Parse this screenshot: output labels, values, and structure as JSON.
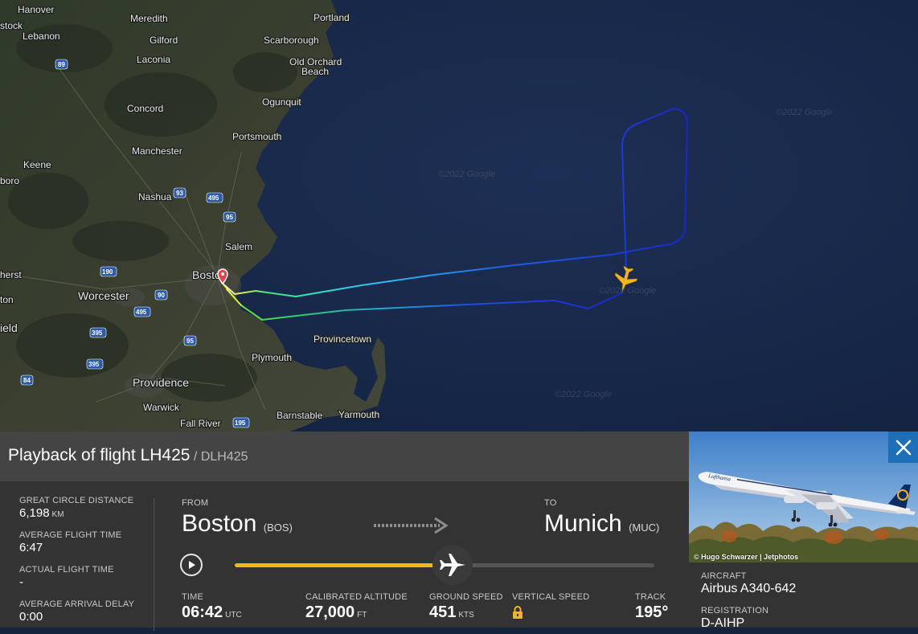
{
  "map": {
    "labels": {
      "hanover": "Hanover",
      "meredith": "Meredith",
      "portland": "Portland",
      "stock": "stock",
      "lebanon": "Lebanon",
      "gilford": "Gilford",
      "scarborough": "Scarborough",
      "laconia": "Laconia",
      "old_orchard": "Old Orchard",
      "beach": "Beach",
      "ogunquit": "Ogunquit",
      "concord": "Concord",
      "portsmouth": "Portsmouth",
      "manchester": "Manchester",
      "keene": "Keene",
      "boro": "boro",
      "nashua": "Nashua",
      "salem": "Salem",
      "herst": "herst",
      "boston": "Boston",
      "worcester": "Worcester",
      "ton": "ton",
      "field": "ield",
      "provincetown": "Provincetown",
      "plymouth": "Plymouth",
      "providence": "Providence",
      "warwick": "Warwick",
      "fall_river": "Fall River",
      "barnstable": "Barnstable",
      "yarmouth": "Yarmouth"
    },
    "shields": {
      "s89": "89",
      "s93a": "93",
      "s495a": "495",
      "s95a": "95",
      "s190": "190",
      "s90": "90",
      "s495b": "495",
      "s395a": "395",
      "s95b": "95",
      "s395b": "395",
      "s84": "84",
      "s195": "195"
    }
  },
  "flight": {
    "title": "Playback of flight LH425",
    "callsign": "/ DLH425",
    "from_label": "FROM",
    "from_city": "Boston",
    "from_code": "(BOS)",
    "to_label": "TO",
    "to_city": "Munich",
    "to_code": "(MUC)",
    "progress": 0.52,
    "colors": {
      "progress": "#f2b51d",
      "aircraft": "#f2b51d"
    }
  },
  "stats": {
    "gcd_label": "GREAT CIRCLE DISTANCE",
    "gcd_value": "6,198",
    "gcd_unit": "KM",
    "aft_label": "AVERAGE FLIGHT TIME",
    "aft_value": "6:47",
    "act_label": "ACTUAL FLIGHT TIME",
    "act_value": "-",
    "aad_label": "AVERAGE ARRIVAL DELAY",
    "aad_value": "0:00"
  },
  "telemetry": {
    "time_label": "TIME",
    "time_value": "06:42",
    "time_unit": "UTC",
    "alt_label": "CALIBRATED ALTITUDE",
    "alt_value": "27,000",
    "alt_unit": "FT",
    "gs_label": "GROUND SPEED",
    "gs_value": "451",
    "gs_unit": "KTS",
    "vs_label": "VERTICAL SPEED",
    "track_label": "TRACK",
    "track_value": "195°"
  },
  "aircraft": {
    "photo_credit": "© Hugo Schwarzer | Jetphotos",
    "aircraft_label": "AIRCRAFT",
    "aircraft_value": "Airbus A340-642",
    "reg_label": "REGISTRATION",
    "reg_value": "D-AIHP",
    "livery_text": "Lufthansa"
  },
  "icons": [
    "play-icon",
    "close-icon",
    "lock-icon",
    "airplane-icon",
    "route-arrow-icon",
    "origin-pin-icon"
  ]
}
